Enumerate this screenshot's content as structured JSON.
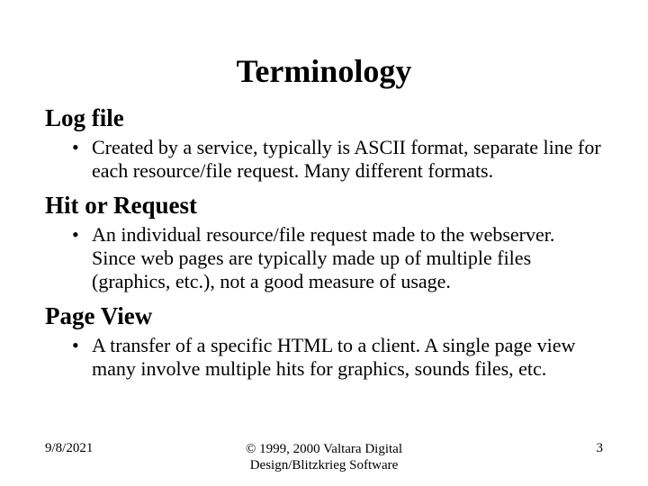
{
  "title": "Terminology",
  "sections": [
    {
      "heading": "Log file",
      "bullet": "Created by a service, typically is ASCII format, separate line for each resource/file request. Many different formats."
    },
    {
      "heading": "Hit or Request",
      "bullet": "An individual resource/file request made to the webserver. Since web pages are typically made up of multiple files (graphics, etc.), not a good measure of usage."
    },
    {
      "heading": "Page View",
      "bullet": "A transfer of a specific HTML to a client. A single page view many involve multiple hits for graphics, sounds files, etc."
    }
  ],
  "footer": {
    "date": "9/8/2021",
    "copyright_line1": "© 1999, 2000 Valtara Digital",
    "copyright_line2": "Design/Blitzkrieg Software",
    "page_number": "3"
  }
}
